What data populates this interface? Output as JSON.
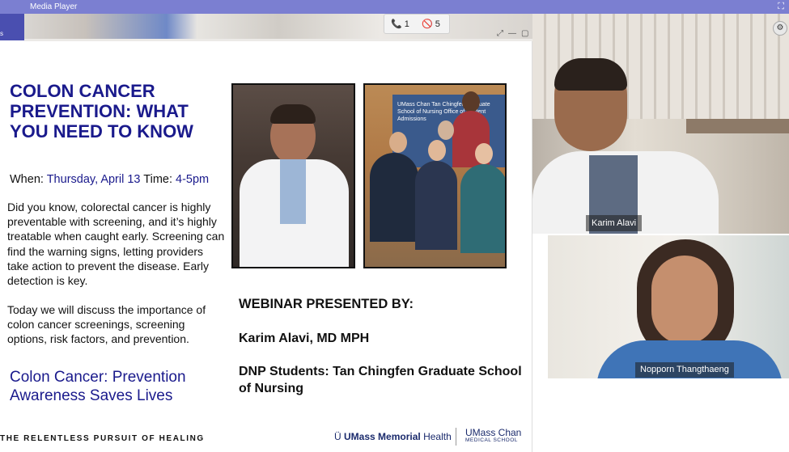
{
  "window": {
    "title": "Media Player",
    "maximize_icon": "expand-icon"
  },
  "app": {
    "side_label": "s"
  },
  "badges": {
    "calls": "1",
    "video_off": "5"
  },
  "slide": {
    "title": "COLON CANCER PREVENTION: WHAT YOU NEED TO KNOW",
    "when_label": "When:",
    "when_value": "Thursday, April 13",
    "time_label": "Time:",
    "time_value": "4-5pm",
    "intro": "Did you know, colorectal cancer is highly preventable with screening, and it’s highly treatable when caught early. Screening can find the warning signs, letting providers take action to prevent the disease. Early detection is key.",
    "discuss": "Today we will discuss the importance of colon cancer screenings, screening options, risk factors, and prevention.",
    "tagline": "Colon Cancer: Prevention Awareness Saves Lives",
    "presented_by": "WEBINAR PRESENTED BY:",
    "presenter": "Karim Alavi, MD MPH",
    "students": "DNP Students: Tan Chingfen Graduate School of Nursing",
    "footer_left": "THE RELENTLESS PURSUIT OF HEALING",
    "footer_umm_bold": "UMass Memorial",
    "footer_umm_rest": "Health",
    "footer_chan": "UMass Chan",
    "footer_chan_sub": "MEDICAL SCHOOL",
    "banner_text": "UMass Chan Tan Chingfen Graduate School of Nursing Office of Student Admissions"
  },
  "participants": [
    {
      "name": "Karim Alavi"
    },
    {
      "name": "Nopporn Thangthaeng"
    }
  ]
}
